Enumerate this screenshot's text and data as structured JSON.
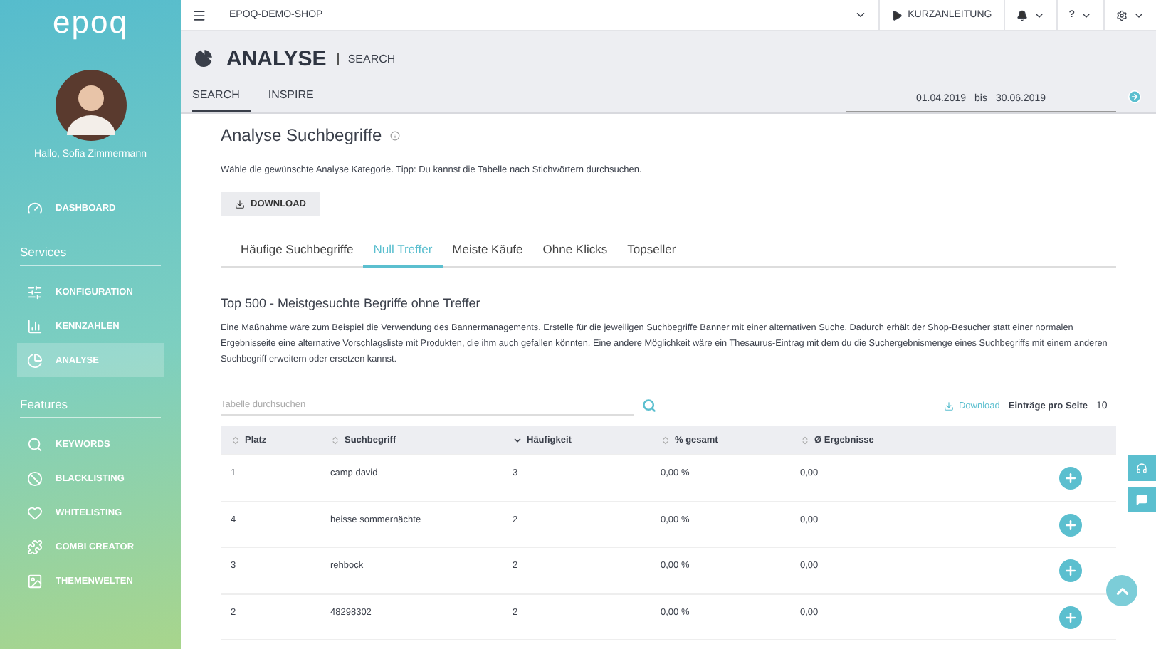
{
  "sidebar": {
    "logo": "epoq",
    "greeting": "Hallo, Sofia Zimmermann",
    "sections": [
      {
        "items": [
          {
            "label": "DASHBOARD",
            "selected": false
          }
        ]
      },
      {
        "heading": "Services",
        "items": [
          {
            "label": "KONFIGURATION",
            "selected": false
          },
          {
            "label": "KENNZAHLEN",
            "selected": false
          },
          {
            "label": "ANALYSE",
            "selected": true
          }
        ]
      },
      {
        "heading": "Features",
        "items": [
          {
            "label": "KEYWORDS",
            "selected": false
          },
          {
            "label": "BLACKLISTING",
            "selected": false
          },
          {
            "label": "WHITELISTING",
            "selected": false
          },
          {
            "label": "COMBI CREATOR",
            "selected": false
          },
          {
            "label": "THEMENWELTEN",
            "selected": false
          }
        ]
      }
    ]
  },
  "topbar": {
    "shop": "EPOQ-DEMO-SHOP",
    "guide": "KURZANLEITUNG",
    "help": "?"
  },
  "header": {
    "title": "ANALYSE",
    "subtitle": "SEARCH",
    "tabs": [
      {
        "label": "SEARCH",
        "selected": true
      },
      {
        "label": "INSPIRE",
        "selected": false
      }
    ],
    "date_from": "01.04.2019",
    "date_sep": "bis",
    "date_to": "30.06.2019"
  },
  "content": {
    "title": "Analyse Suchbegriffe",
    "intro": "Wähle die gewünschte Analyse Kategorie. Tipp: Du kannst die Tabelle nach Stichwörtern durchsuchen.",
    "download": "DOWNLOAD",
    "categories": [
      {
        "label": "Häufige Suchbegriffe",
        "selected": false
      },
      {
        "label": "Null Treffer",
        "selected": true
      },
      {
        "label": "Meiste Käufe",
        "selected": false
      },
      {
        "label": "Ohne Klicks",
        "selected": false
      },
      {
        "label": "Topseller",
        "selected": false
      }
    ],
    "section_title": "Top 500 - Meistgesuchte Begriffe ohne Treffer",
    "section_text": "Eine Maßnahme wäre zum Beispiel die Verwendung des Bannermanagements. Erstelle für die jeweiligen Suchbegriffe Banner mit einer alternativen Suche. Dadurch erhält der Shop-Besucher statt einer normalen Ergebnisseite eine alternative Vorschlagsliste mit Produkten, die ihm auch gefallen könnten. Eine andere Möglichkeit wäre ein Thesaurus-Eintrag mit dem du die Suchergebnismenge eines Suchbegriffs mit einem anderen Suchbegriff erweitern oder ersetzen kannst.",
    "search_placeholder": "Tabelle durchsuchen",
    "table_download": "Download",
    "per_page_label": "Einträge pro Seite",
    "per_page": "10"
  },
  "table": {
    "columns": [
      {
        "label": "Platz",
        "sorted": false
      },
      {
        "label": "Suchbegriff",
        "sorted": false
      },
      {
        "label": "Häufigkeit",
        "sorted": true
      },
      {
        "label": "% gesamt",
        "sorted": false
      },
      {
        "label": "Ø Ergebnisse",
        "sorted": false
      }
    ],
    "rows": [
      [
        "1",
        "camp david",
        "3",
        "0,00 %",
        "0,00"
      ],
      [
        "4",
        "heisse sommernächte",
        "2",
        "0,00 %",
        "0,00"
      ],
      [
        "3",
        "rehbock",
        "2",
        "0,00 %",
        "0,00"
      ],
      [
        "2",
        "48298302",
        "2",
        "0,00 %",
        "0,00"
      ]
    ]
  }
}
